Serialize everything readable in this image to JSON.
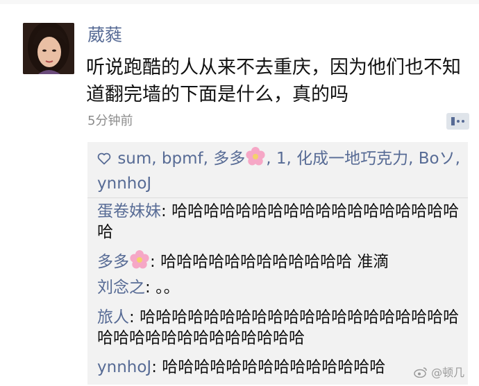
{
  "post": {
    "username": "葳蕤",
    "text": "听说跑酷的人从来不去重庆，因为他们也不知道翻完墙的下面是什么，真的吗",
    "timestamp": "5分钟前"
  },
  "likes": {
    "names_before_flower": "sum, bpmf, 多多",
    "names_after_flower": ", 1, 化成一地巧克力, Boソ, ynnhoJ",
    "icon": "heart-outline-icon",
    "color": "#576b95"
  },
  "comments": [
    {
      "author": "蛋卷妹妹",
      "separator": ": ",
      "text": "哈哈哈哈哈哈哈哈哈哈哈哈哈哈哈哈哈哈哈",
      "flower": false
    },
    {
      "author": "多多",
      "separator": ": ",
      "text": "哈哈哈哈哈哈哈哈哈哈哈哈 准滴",
      "flower": true
    },
    {
      "author": "刘念之",
      "separator": ": ",
      "text": "。。",
      "flower": false
    },
    {
      "author": "旅人",
      "separator": ": ",
      "text": "哈哈哈哈哈哈哈哈哈哈哈哈哈哈哈哈哈哈哈哈哈哈哈哈哈哈哈哈哈哈哈哈哈",
      "flower": false
    },
    {
      "author": "ynnhoJ",
      "separator": ": ",
      "text": "哈哈哈哈哈哈哈哈哈哈哈哈哈哈",
      "flower": false
    }
  ],
  "watermark": {
    "text": "@顿几",
    "icon": "weibo-logo-icon"
  },
  "colors": {
    "link_blue": "#576b95",
    "panel_bg": "#f2f2f2",
    "meta_gray": "#8c8c8c"
  }
}
